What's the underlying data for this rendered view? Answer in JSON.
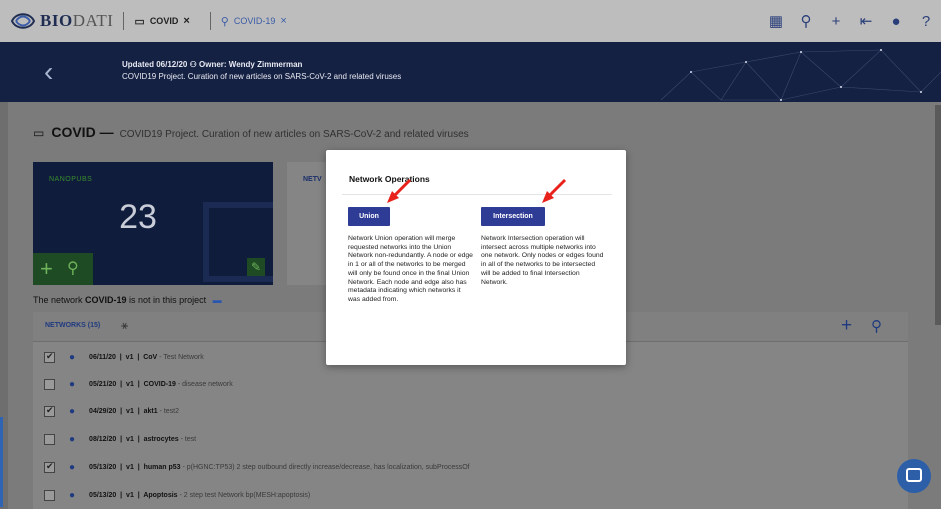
{
  "app": {
    "brand_main": "BIO",
    "brand_rest": "DATI"
  },
  "tabs": [
    {
      "label": "COVID"
    },
    {
      "label": "COVID-19"
    }
  ],
  "banner": {
    "line1": "Updated 06/12/20 B Owner: Wendy Zimmerman",
    "updated": "Updated 06/12/20",
    "owner": "Owner: Wendy Zimmerman",
    "line2": "COVID19 Project. Curation of new articles on SARS-CoV-2 and related viruses"
  },
  "project": {
    "name": "COVID —",
    "description": "COVID19 Project. Curation of new articles on SARS-CoV-2 and related viruses"
  },
  "nanopubs": {
    "label": "NANOPUBS",
    "count": "23"
  },
  "networks_card": {
    "label": "NETV"
  },
  "notice": {
    "prefix": "The network ",
    "network": "COVID-19",
    "suffix": " is not in this project"
  },
  "networks_panel": {
    "title": "NETWORKS (15)"
  },
  "networks": [
    {
      "checked": true,
      "date": "06/11/20",
      "version": "v1",
      "name": "CoV",
      "desc": " - Test Network"
    },
    {
      "checked": false,
      "date": "05/21/20",
      "version": "v1",
      "name": "COVID-19",
      "desc": " - disease network"
    },
    {
      "checked": true,
      "date": "04/29/20",
      "version": "v1",
      "name": "akt1",
      "desc": " - test2"
    },
    {
      "checked": false,
      "date": "08/12/20",
      "version": "v1",
      "name": "astrocytes",
      "desc": " - test"
    },
    {
      "checked": true,
      "date": "05/13/20",
      "version": "v1",
      "name": "human p53",
      "desc": " - p(HGNC:TP53) 2 step outbound directly increase/decrease, has localization, subProcessOf"
    },
    {
      "checked": false,
      "date": "05/13/20",
      "version": "v1",
      "name": "Apoptosis",
      "desc": " - 2 step test Network bp(MESH:apoptosis)"
    }
  ],
  "modal": {
    "title": "Network Operations",
    "union_button": "Union",
    "intersection_button": "Intersection",
    "union_desc": "Network Union operation will merge requested networks into the Union Network non-redundantly. A node or edge in 1 or all of the networks to be merged will only be found once in the final Union Network. Each node and edge also has metadata indicating which networks it was added from.",
    "intersection_desc": "Network Intersection operation will intersect across multiple networks into one network. Only nodes or edges found in all of the networks to be intersected will be added to final Intersection Network."
  },
  "icons": {
    "top_right": [
      "grid-icon",
      "search-icon",
      "plus-icon",
      "import-icon",
      "user-icon",
      "help-icon"
    ],
    "accent_color": "#2f3c96",
    "banner_color": "#152143",
    "nanopub_green": "#3a8c2c",
    "arrow_color": "#e8221b"
  }
}
